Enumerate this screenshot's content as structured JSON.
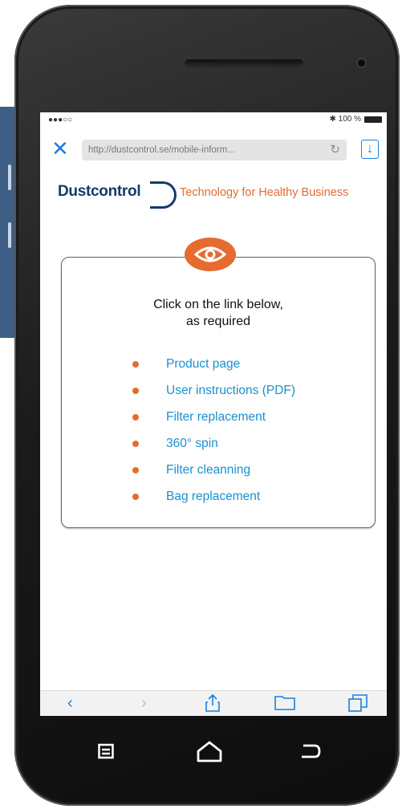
{
  "statusbar": {
    "signal": "●●●○○",
    "battery_text": "✱ 100 %"
  },
  "browser": {
    "url": "http://dustcontrol.se/mobile-inform...",
    "close_icon": "close-icon",
    "reload_icon": "reload-icon",
    "share_icon": "share-icon"
  },
  "brand": {
    "logo": "Dustcontrol",
    "tagline": "Technology for Healthy Business"
  },
  "card": {
    "instruction_line1": "Click on the link below,",
    "instruction_line2": "as required",
    "links": [
      "Product page",
      "User instructions (PDF)",
      "Filter replacement",
      "360° spin",
      "Filter cleanning",
      "Bag replacement"
    ]
  },
  "toolbar": {
    "icons": [
      "back-icon",
      "forward-icon",
      "share-icon",
      "bookmarks-icon",
      "tabs-icon"
    ]
  },
  "softkeys": {
    "icons": [
      "menu-icon",
      "home-icon",
      "back-icon"
    ]
  },
  "colors": {
    "accent": "#e56b2f",
    "link": "#1a90d0",
    "brand": "#163a6b",
    "ios_blue": "#1a7fe0"
  }
}
